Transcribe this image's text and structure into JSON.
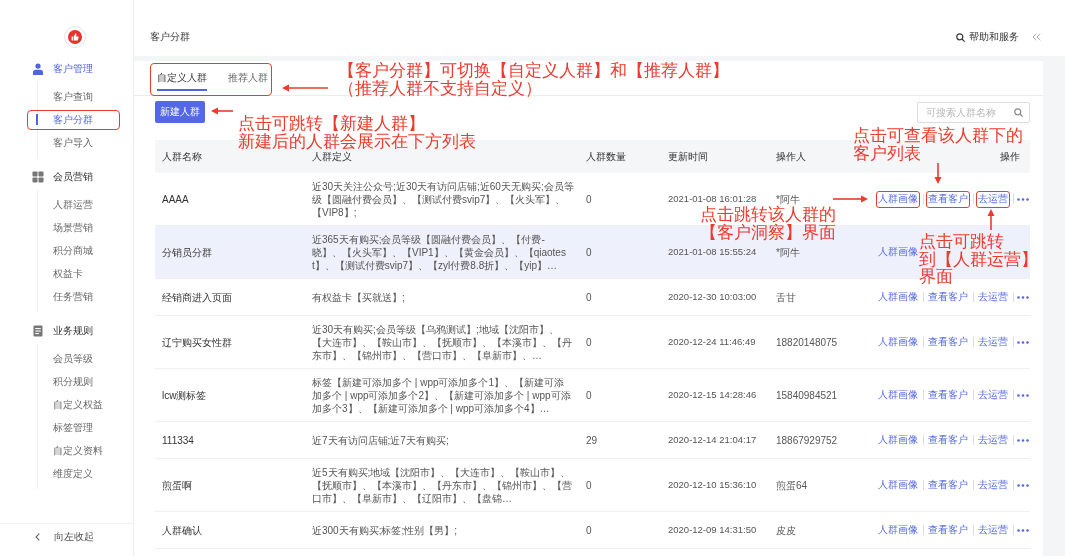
{
  "sidebar": {
    "groups": [
      {
        "label": "客户管理",
        "active": true,
        "items": [
          {
            "label": "客户查询",
            "selected": false,
            "callout": false
          },
          {
            "label": "客户分群",
            "selected": true,
            "callout": true
          },
          {
            "label": "客户导入",
            "selected": false,
            "callout": false
          }
        ]
      },
      {
        "label": "会员营销",
        "active": false,
        "items": [
          {
            "label": "人群运营",
            "selected": false,
            "callout": false
          },
          {
            "label": "场景营销",
            "selected": false,
            "callout": false
          },
          {
            "label": "积分商城",
            "selected": false,
            "callout": false
          },
          {
            "label": "权益卡",
            "selected": false,
            "callout": false
          },
          {
            "label": "任务营销",
            "selected": false,
            "callout": false
          }
        ]
      },
      {
        "label": "业务规则",
        "active": false,
        "items": [
          {
            "label": "会员等级",
            "selected": false,
            "callout": false
          },
          {
            "label": "积分规则",
            "selected": false,
            "callout": false
          },
          {
            "label": "自定义权益",
            "selected": false,
            "callout": false
          },
          {
            "label": "标签管理",
            "selected": false,
            "callout": false
          },
          {
            "label": "自定义资料",
            "selected": false,
            "callout": false
          },
          {
            "label": "维度定义",
            "selected": false,
            "callout": false
          }
        ]
      }
    ],
    "collapse_label": "向左收起"
  },
  "header": {
    "title": "客户分群",
    "help": "帮助和服务"
  },
  "tab_bar": {
    "callout": true,
    "tabs": [
      {
        "label": "自定义人群",
        "selected": true
      },
      {
        "label": "推荐人群",
        "selected": false
      }
    ]
  },
  "toolbar": {
    "create_button": "新建人群",
    "search": {
      "placeholder": "可搜索人群名称"
    }
  },
  "table": {
    "columns": [
      "人群名称",
      "人群定义",
      "人群数量",
      "更新时间",
      "操作人",
      "操作"
    ],
    "rows": [
      {
        "name": "AAAA",
        "definition": "近30天关注公众号;近30天有访问店铺;近60天无购买;会员等级【圆融付费会员】、【测试付费svip7】、【火头军】、【VIP8】;",
        "count": "0",
        "updated": "2021-01-08 16:01:28",
        "operator": "*阿牛",
        "hovered": false,
        "actions": [
          {
            "kind": "link",
            "label": "人群画像",
            "callout": true
          },
          {
            "kind": "link",
            "label": "查看客户",
            "callout": true
          },
          {
            "kind": "link",
            "label": "去运营",
            "callout": true
          },
          {
            "kind": "more"
          }
        ]
      },
      {
        "name": "分销员分群",
        "definition": "近365天有购买;会员等级【圆融付费会员】、【付费-晓】、【火头军】、【VIP1】、【黄金会员】、【qiaotest】、【测试付费svip7】、【zyl付费8.8折】、【yip】…",
        "count": "0",
        "updated": "2021-01-08 15:55:24",
        "operator": "*阿牛",
        "hovered": true,
        "actions": [
          {
            "kind": "link",
            "label": "人群画像",
            "callout": false
          }
        ]
      },
      {
        "name": "经销商进入页面",
        "definition": "有权益卡【买就送】;",
        "count": "0",
        "updated": "2020-12-30 10:03:00",
        "operator": "舌甘",
        "hovered": false,
        "actions": [
          {
            "kind": "link",
            "label": "人群画像",
            "callout": false
          },
          {
            "kind": "link",
            "label": "查看客户",
            "callout": false
          },
          {
            "kind": "link",
            "label": "去运营",
            "callout": false
          },
          {
            "kind": "more"
          }
        ]
      },
      {
        "name": "辽宁购买女性群",
        "definition": "近30天有购买;会员等级【乌鸦测试】;地域【沈阳市】、【大连市】、【鞍山市】、【抚顺市】、【本溪市】、【丹东市】、【锦州市】、【营口市】、【阜新市】、…",
        "count": "0",
        "updated": "2020-12-24 11:46:49",
        "operator": "18820148075",
        "hovered": false,
        "actions": [
          {
            "kind": "link",
            "label": "人群画像",
            "callout": false
          },
          {
            "kind": "link",
            "label": "查看客户",
            "callout": false
          },
          {
            "kind": "link",
            "label": "去运营",
            "callout": false
          },
          {
            "kind": "more"
          }
        ]
      },
      {
        "name": "lcw测标签",
        "definition": "标签【新建可添加多个 | wpp可添加多个1】、【新建可添加多个 | wpp可添加多个2】、【新建可添加多个 | wpp可添加多个3】、【新建可添加多个 | wpp可添加多个4】…",
        "count": "0",
        "updated": "2020-12-15 14:28:46",
        "operator": "15840984521",
        "hovered": false,
        "actions": [
          {
            "kind": "link",
            "label": "人群画像",
            "callout": false
          },
          {
            "kind": "link",
            "label": "查看客户",
            "callout": false
          },
          {
            "kind": "link",
            "label": "去运营",
            "callout": false
          },
          {
            "kind": "more"
          }
        ]
      },
      {
        "name": "111334",
        "definition": "近7天有访问店铺;近7天有购买;",
        "count": "29",
        "updated": "2020-12-14 21:04:17",
        "operator": "18867929752",
        "hovered": false,
        "actions": [
          {
            "kind": "link",
            "label": "人群画像",
            "callout": false
          },
          {
            "kind": "link",
            "label": "查看客户",
            "callout": false
          },
          {
            "kind": "link",
            "label": "去运营",
            "callout": false
          },
          {
            "kind": "more"
          }
        ]
      },
      {
        "name": "煎蛋啊",
        "definition": "近5天有购买;地域【沈阳市】、【大连市】、【鞍山市】、【抚顺市】、【本溪市】、【丹东市】、【锦州市】、【营口市】、【阜新市】、【辽阳市】、【盘锦…",
        "count": "0",
        "updated": "2020-12-10 15:36:10",
        "operator": "煎蛋64",
        "hovered": false,
        "actions": [
          {
            "kind": "link",
            "label": "人群画像",
            "callout": false
          },
          {
            "kind": "link",
            "label": "查看客户",
            "callout": false
          },
          {
            "kind": "link",
            "label": "去运营",
            "callout": false
          },
          {
            "kind": "more"
          }
        ]
      },
      {
        "name": "人群确认",
        "definition": "近300天有购买;标签;性别【男】;",
        "count": "0",
        "updated": "2020-12-09 14:31:50",
        "operator": "皮皮",
        "hovered": false,
        "actions": [
          {
            "kind": "link",
            "label": "人群画像",
            "callout": false
          },
          {
            "kind": "link",
            "label": "查看客户",
            "callout": false
          },
          {
            "kind": "link",
            "label": "去运营",
            "callout": false
          },
          {
            "kind": "more"
          }
        ]
      }
    ]
  },
  "annotations": [
    {
      "kind": "left",
      "lines": [
        "【客户分群】可切换【自定义人群】和【推荐人群】",
        "（推荐人群不支持自定义）"
      ]
    },
    {
      "kind": "left",
      "lines": [
        "点击可跳转【新建人群】",
        "新建后的人群会展示在下方列表"
      ]
    },
    {
      "kind": "down",
      "lines": [
        "点击可查看该人群下的",
        "客户列表"
      ]
    },
    {
      "kind": "right",
      "lines": [
        "点击跳转该人群的",
        "【客户洞察】界面"
      ]
    },
    {
      "kind": "up",
      "lines": [
        "点击可跳转",
        "到【人群运营】",
        "界面"
      ]
    }
  ]
}
